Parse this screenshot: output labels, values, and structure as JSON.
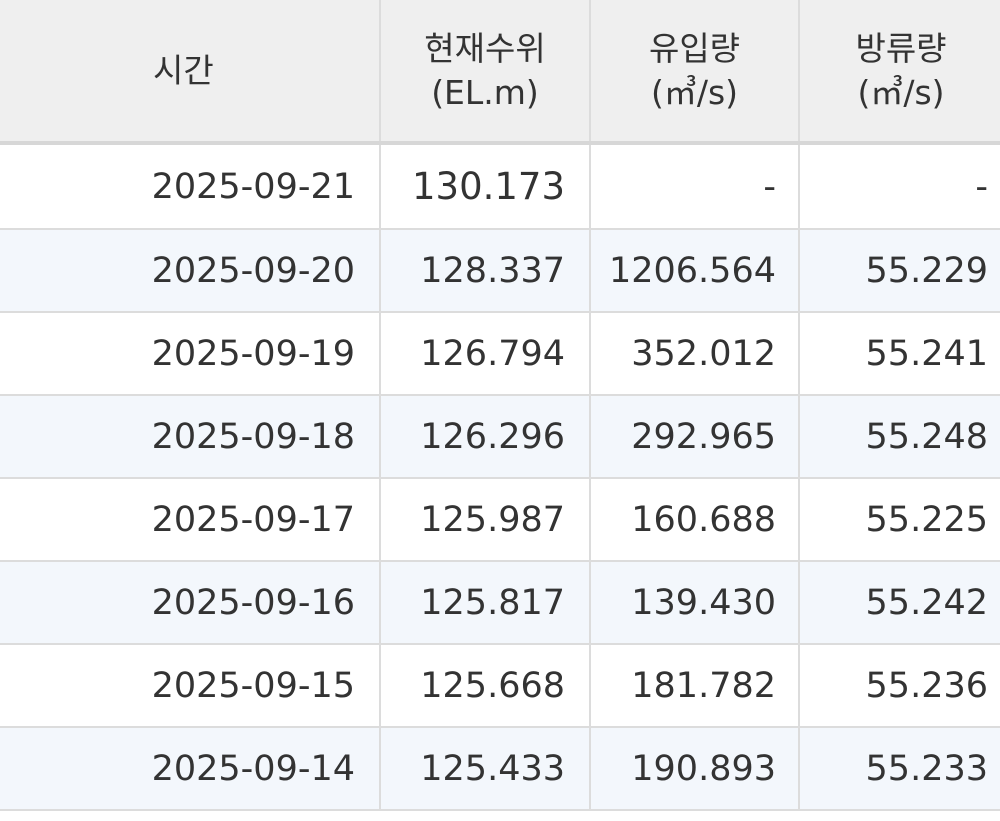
{
  "table": {
    "headers": {
      "time": "시간",
      "level_line1": "현재수위",
      "level_line2": "(EL.m)",
      "inflow_line1": "유입량",
      "inflow_line2": "(㎥/s)",
      "outflow_line1": "방류량",
      "outflow_line2": "(㎥/s)"
    },
    "rows": [
      {
        "time": "2025-09-21",
        "level": "130.173",
        "inflow": "-",
        "outflow": "-"
      },
      {
        "time": "2025-09-20",
        "level": "128.337",
        "inflow": "1206.564",
        "outflow": "55.229"
      },
      {
        "time": "2025-09-19",
        "level": "126.794",
        "inflow": "352.012",
        "outflow": "55.241"
      },
      {
        "time": "2025-09-18",
        "level": "126.296",
        "inflow": "292.965",
        "outflow": "55.248"
      },
      {
        "time": "2025-09-17",
        "level": "125.987",
        "inflow": "160.688",
        "outflow": "55.225"
      },
      {
        "time": "2025-09-16",
        "level": "125.817",
        "inflow": "139.430",
        "outflow": "55.242"
      },
      {
        "time": "2025-09-15",
        "level": "125.668",
        "inflow": "181.782",
        "outflow": "55.236"
      },
      {
        "time": "2025-09-14",
        "level": "125.433",
        "inflow": "190.893",
        "outflow": "55.233"
      }
    ]
  },
  "colors": {
    "header_bg": "#efefef",
    "alt_row_bg": "#f3f7fc",
    "border": "#dcdcdc",
    "text": "#333333"
  }
}
